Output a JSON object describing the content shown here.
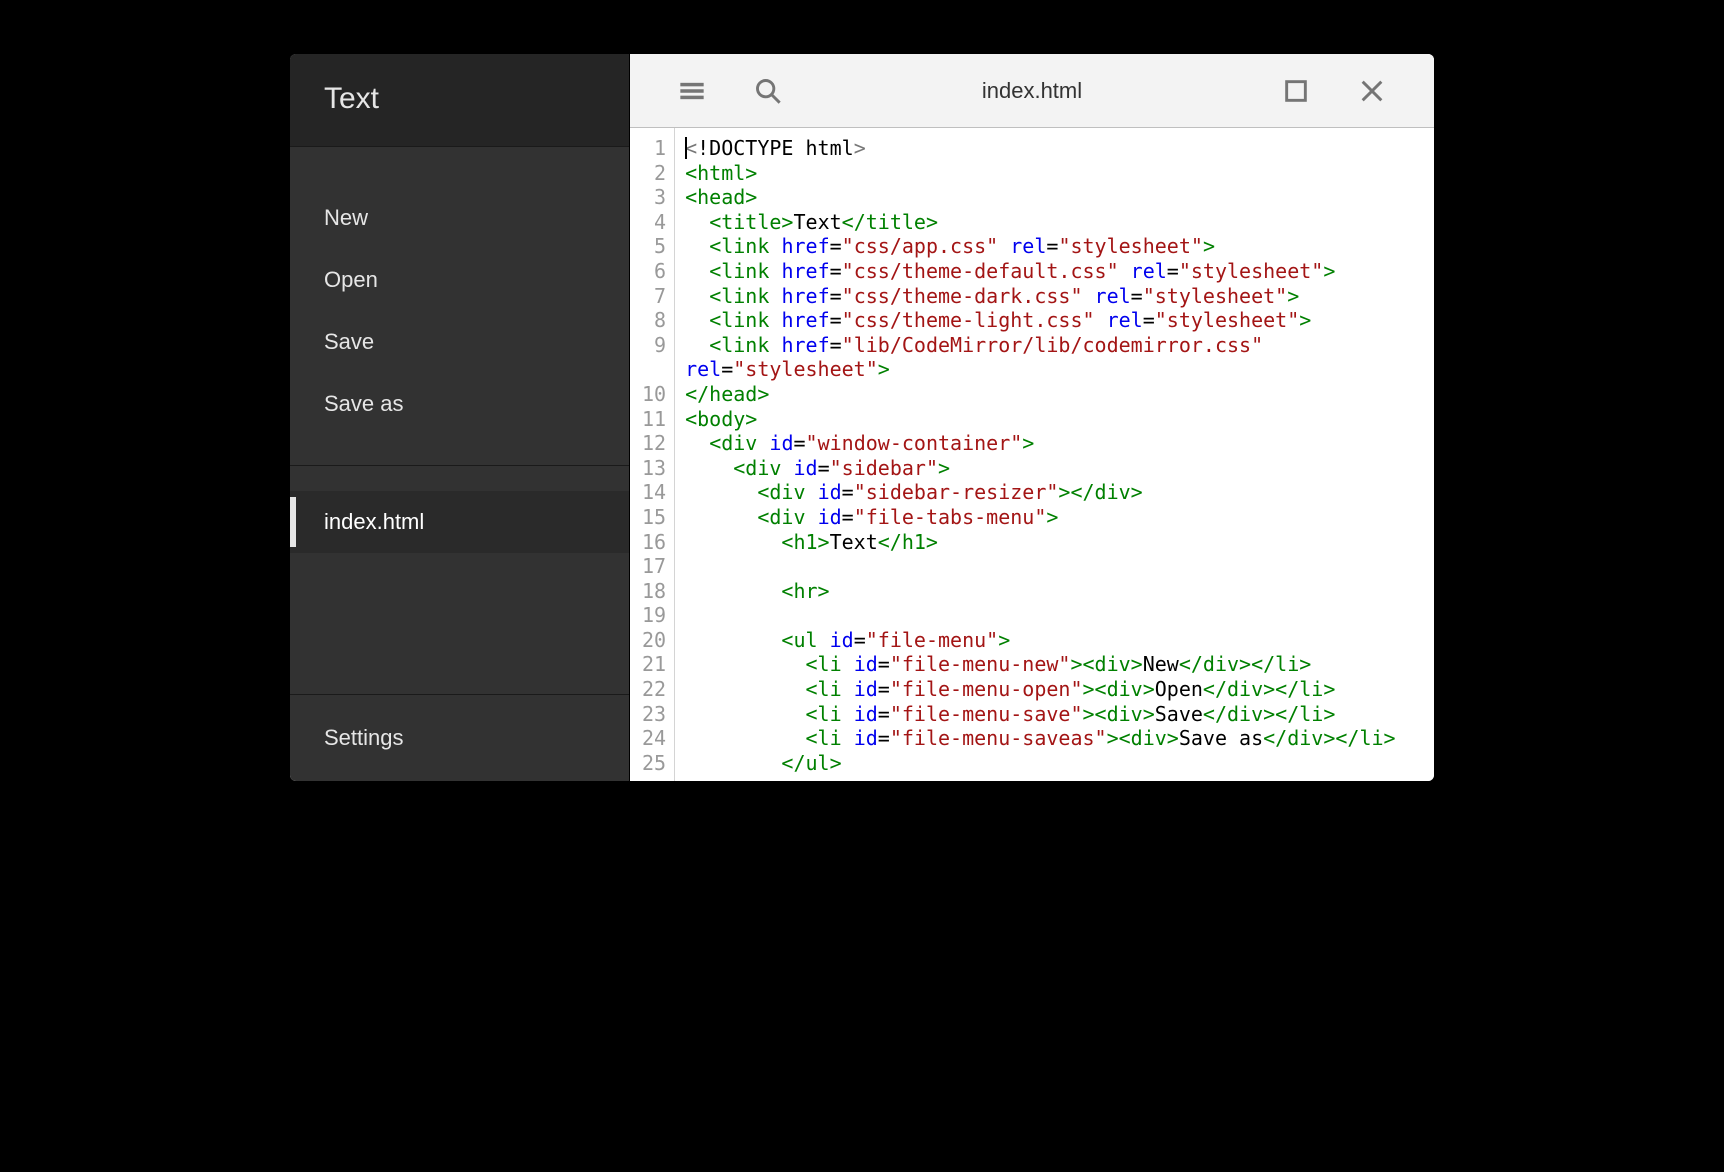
{
  "sidebar": {
    "title": "Text",
    "menu": [
      "New",
      "Open",
      "Save",
      "Save as"
    ],
    "tabs": [
      "index.html"
    ],
    "footer": "Settings"
  },
  "toolbar": {
    "filename": "index.html"
  },
  "editor": {
    "line_count": 25,
    "lines": [
      {
        "type": "doctype",
        "text": "<!DOCTYPE html>"
      },
      {
        "type": "open",
        "tag": "html"
      },
      {
        "type": "open",
        "tag": "head"
      },
      {
        "type": "tag-text",
        "indent": 1,
        "tag": "title",
        "text": "Text"
      },
      {
        "type": "link",
        "indent": 1,
        "href": "css/app.css",
        "rel": "stylesheet"
      },
      {
        "type": "link",
        "indent": 1,
        "href": "css/theme-default.css",
        "rel": "stylesheet"
      },
      {
        "type": "link",
        "indent": 1,
        "href": "css/theme-dark.css",
        "rel": "stylesheet"
      },
      {
        "type": "link",
        "indent": 1,
        "href": "css/theme-light.css",
        "rel": "stylesheet"
      },
      {
        "type": "link-wrap",
        "indent": 1,
        "href": "lib/CodeMirror/lib/codemirror.css",
        "rel": "stylesheet"
      },
      {
        "type": "close",
        "tag": "head"
      },
      {
        "type": "open",
        "tag": "body"
      },
      {
        "type": "open-attr",
        "indent": 1,
        "tag": "div",
        "attr": "id",
        "val": "window-container"
      },
      {
        "type": "open-attr",
        "indent": 2,
        "tag": "div",
        "attr": "id",
        "val": "sidebar"
      },
      {
        "type": "open-close-attr",
        "indent": 3,
        "tag": "div",
        "attr": "id",
        "val": "sidebar-resizer"
      },
      {
        "type": "open-attr",
        "indent": 3,
        "tag": "div",
        "attr": "id",
        "val": "file-tabs-menu"
      },
      {
        "type": "tag-text",
        "indent": 4,
        "tag": "h1",
        "text": "Text"
      },
      {
        "type": "blank"
      },
      {
        "type": "self",
        "indent": 4,
        "tag": "hr"
      },
      {
        "type": "blank"
      },
      {
        "type": "open-attr",
        "indent": 4,
        "tag": "ul",
        "attr": "id",
        "val": "file-menu"
      },
      {
        "type": "li-div",
        "indent": 5,
        "id": "file-menu-new",
        "text": "New"
      },
      {
        "type": "li-div",
        "indent": 5,
        "id": "file-menu-open",
        "text": "Open"
      },
      {
        "type": "li-div",
        "indent": 5,
        "id": "file-menu-save",
        "text": "Save"
      },
      {
        "type": "li-div",
        "indent": 5,
        "id": "file-menu-saveas",
        "text": "Save as"
      },
      {
        "type": "close",
        "indent": 4,
        "tag": "ul"
      }
    ]
  }
}
